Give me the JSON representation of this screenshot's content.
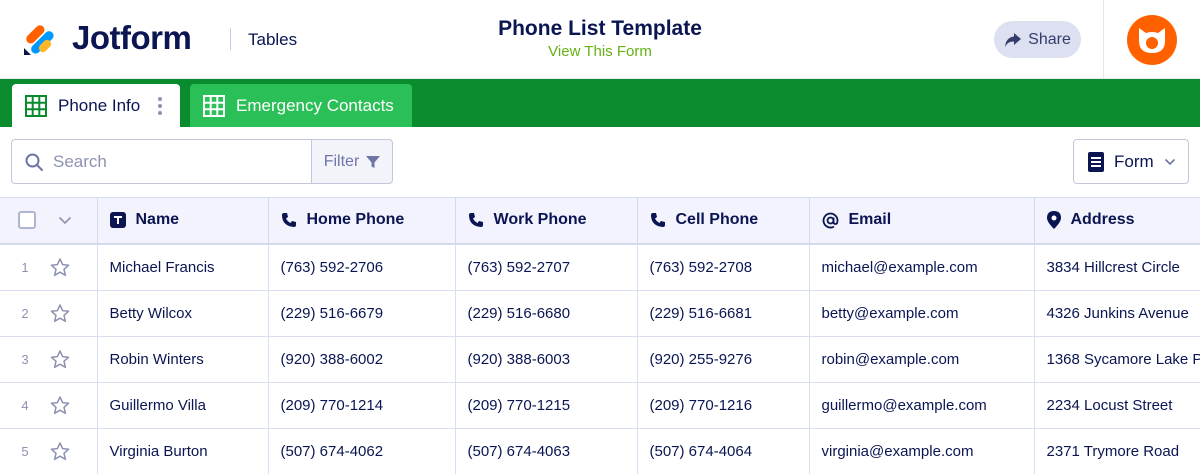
{
  "header": {
    "brand": "Jotform",
    "section": "Tables",
    "title": "Phone List Template",
    "view_link": "View This Form",
    "share_label": "Share"
  },
  "colors": {
    "navy": "#0a1551",
    "green_bar": "#0a8b2e",
    "green_tab": "#2bbf57",
    "link_green": "#64b214",
    "avatar_orange": "#ff6100"
  },
  "tabs": [
    {
      "label": "Phone Info",
      "active": true
    },
    {
      "label": "Emergency Contacts",
      "active": false
    }
  ],
  "toolbar": {
    "search_placeholder": "Search",
    "filter_label": "Filter",
    "form_label": "Form"
  },
  "table": {
    "columns": [
      {
        "label": "Name",
        "icon": "text-type-icon"
      },
      {
        "label": "Home Phone",
        "icon": "phone-icon"
      },
      {
        "label": "Work Phone",
        "icon": "phone-icon"
      },
      {
        "label": "Cell Phone",
        "icon": "phone-icon"
      },
      {
        "label": "Email",
        "icon": "at-sign-icon"
      },
      {
        "label": "Address",
        "icon": "location-pin-icon"
      }
    ],
    "rows": [
      {
        "num": "1",
        "cells": [
          "Michael Francis",
          "(763) 592-2706",
          "(763) 592-2707",
          "(763) 592-2708",
          "michael@example.com",
          "3834 Hillcrest Circle"
        ]
      },
      {
        "num": "2",
        "cells": [
          "Betty Wilcox",
          "(229) 516-6679",
          "(229) 516-6680",
          "(229) 516-6681",
          "betty@example.com",
          "4326 Junkins Avenue"
        ]
      },
      {
        "num": "3",
        "cells": [
          "Robin Winters",
          "(920) 388-6002",
          "(920) 388-6003",
          "(920) 255-9276",
          "robin@example.com",
          "1368 Sycamore Lake P"
        ]
      },
      {
        "num": "4",
        "cells": [
          "Guillermo Villa",
          "(209) 770-1214",
          "(209) 770-1215",
          "(209) 770-1216",
          "guillermo@example.com",
          "2234 Locust Street"
        ]
      },
      {
        "num": "5",
        "cells": [
          "Virginia Burton",
          "(507) 674-4062",
          "(507) 674-4063",
          "(507) 674-4064",
          "virginia@example.com",
          "2371 Trymore Road"
        ]
      }
    ]
  }
}
